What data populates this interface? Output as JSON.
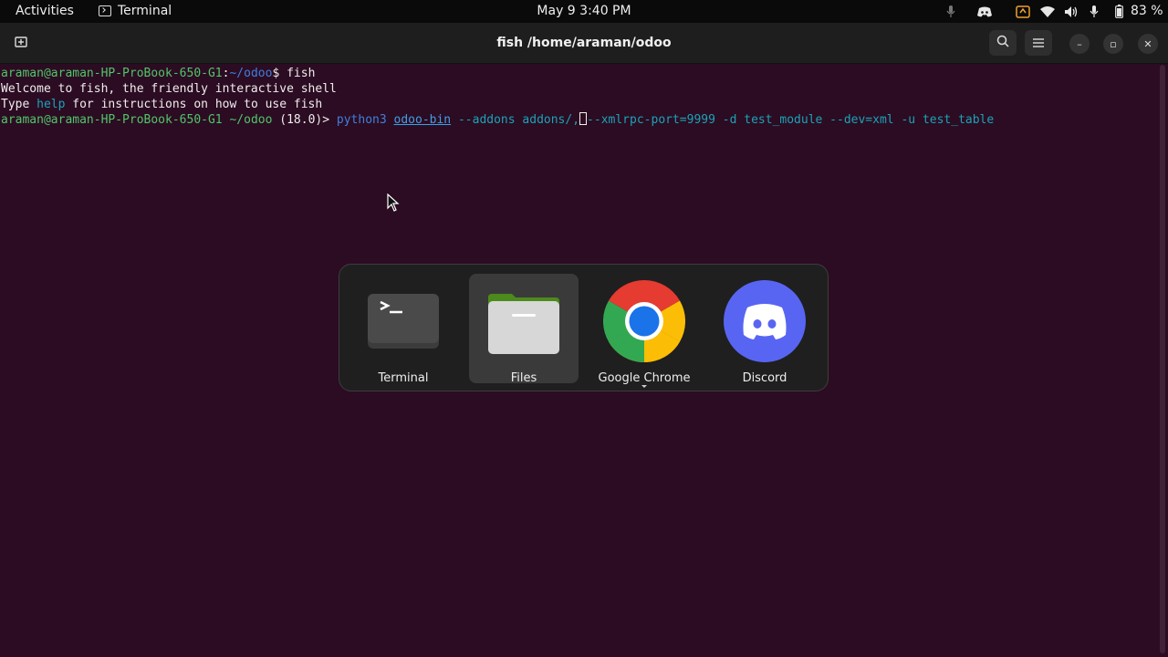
{
  "topbar": {
    "activities": "Activities",
    "app_name": "Terminal",
    "clock": "May 9  3:40 PM",
    "battery": "83 %"
  },
  "window": {
    "title": "fish /home/araman/odoo"
  },
  "terminal": {
    "line1": {
      "user_host": "araman@araman-HP-ProBook-650-G1",
      "sep": ":",
      "path": "~/odoo",
      "rest": "$ fish"
    },
    "line2": "Welcome to fish, the friendly interactive shell",
    "line3": {
      "a": "Type ",
      "help": "help",
      "b": " for instructions on how to use fish"
    },
    "line4": {
      "user_host": "araman@araman-HP-ProBook-650-G1",
      "path": "~/odoo",
      "branch": "(18.0)>",
      "cmd": "python3",
      "file": "odoo-bin",
      "arg1": "--addons",
      "arg2": "addons/,",
      "arg3": "--xmlrpc-port=9999",
      "arg4": "-d",
      "arg5": "test_module",
      "arg6": "--dev=xml",
      "arg7": "-u",
      "arg8": "test_table"
    }
  },
  "switcher": {
    "apps": [
      {
        "label": "Terminal"
      },
      {
        "label": "Files"
      },
      {
        "label": "Google Chrome"
      },
      {
        "label": "Discord"
      }
    ],
    "selected": "Files"
  },
  "colors": {
    "terminal_bg": "#2c0c22",
    "prompt_green": "#50c56a",
    "command_blue": "#3f7fe0",
    "discord": "#5865f2"
  }
}
